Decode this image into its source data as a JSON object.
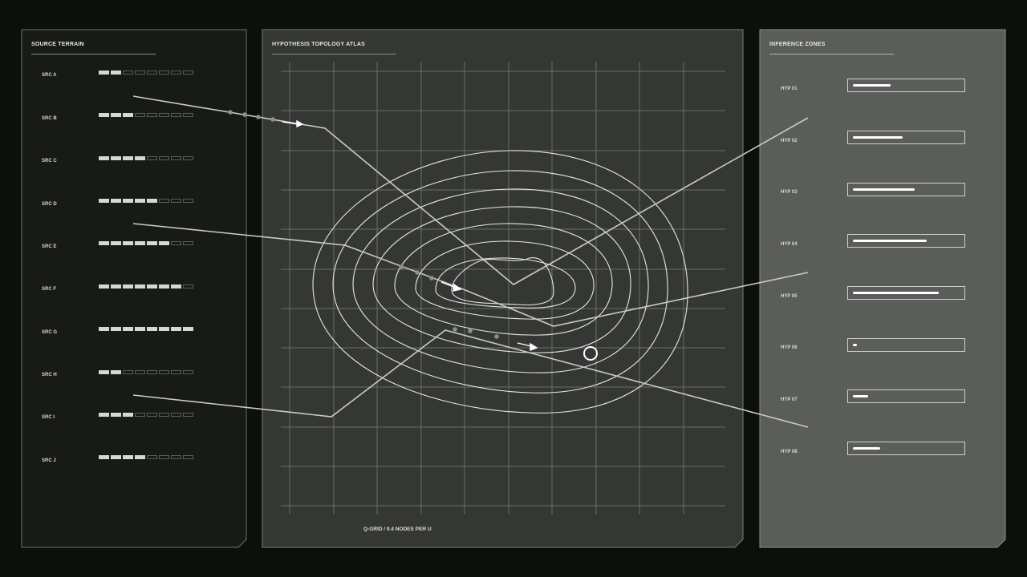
{
  "panels": {
    "source_title": "SOURCE TERRAIN",
    "atlas_title": "HYPOTHESIS TOPOLOGY ATLAS",
    "inference_title": "INFERENCE ZONES"
  },
  "sources": [
    {
      "label": "SRC A",
      "level": 2
    },
    {
      "label": "SRC B",
      "level": 3
    },
    {
      "label": "SRC C",
      "level": 4
    },
    {
      "label": "SRC D",
      "level": 5
    },
    {
      "label": "SRC E",
      "level": 6
    },
    {
      "label": "SRC F",
      "level": 7
    },
    {
      "label": "SRC G",
      "level": 8
    },
    {
      "label": "SRC H",
      "level": 2
    },
    {
      "label": "SRC I",
      "level": 3
    },
    {
      "label": "SRC J",
      "level": 4
    }
  ],
  "source_segment_count": 8,
  "hypotheses": [
    {
      "label": "HYP 01",
      "fill": 0.35
    },
    {
      "label": "HYP 02",
      "fill": 0.46
    },
    {
      "label": "HYP 03",
      "fill": 0.57
    },
    {
      "label": "HYP 04",
      "fill": 0.68
    },
    {
      "label": "HYP 05",
      "fill": 0.79
    },
    {
      "label": "HYP 06",
      "fill": 0.03
    },
    {
      "label": "HYP 07",
      "fill": 0.14
    },
    {
      "label": "HYP 08",
      "fill": 0.25
    }
  ],
  "grid_caption": "Q-GRID / 9.4 NODES PER U",
  "colors": {
    "background": "#0d0f0d",
    "source_panel": "#181a18",
    "atlas_panel": "#353735",
    "inference_panel": "#5b5d5a",
    "line": "#e8eae6"
  }
}
